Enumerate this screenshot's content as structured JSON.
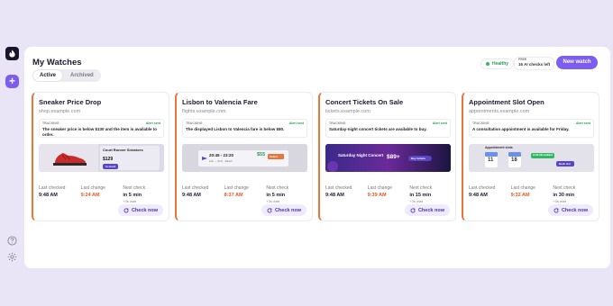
{
  "sidebar": {
    "logo_icon": "flame-logo-icon",
    "add_label": "+",
    "help_icon": "help-icon",
    "settings_icon": "gear-icon"
  },
  "header": {
    "title": "My Watches",
    "tabs": [
      "Active",
      "Archived"
    ],
    "status": "Healthy",
    "plan_name": "FREE",
    "plan_info": "16 AI checks left",
    "new_watch": "New watch"
  },
  "labels": {
    "tracking": "TRACKING",
    "alert": "Alert sent",
    "last_checked": "Last checked",
    "last_change": "Last change",
    "next_check": "Next check",
    "check_now": "Check now"
  },
  "cards": [
    {
      "title": "Sneaker Price Drop",
      "url": "shop.example.com",
      "tracking": "The sneaker price is below $130 and the item is available to order.",
      "last_checked": "9:48 AM",
      "last_change": "9:24 AM",
      "next_check": "in 5 min",
      "next_sub": "+3s wait",
      "preview": {
        "product": "Court Runner Sneakers",
        "price": "$129",
        "badge": "In stock"
      }
    },
    {
      "title": "Lisbon to Valencia Fare",
      "url": "flights.example.com",
      "tracking": "The displayed Lisbon to Valencia fare is below $80.",
      "last_checked": "9:48 AM",
      "last_change": "8:37 AM",
      "next_check": "in 5 min",
      "next_sub": "+3s wait",
      "preview": {
        "times": "20:45 - 23:20",
        "route": "LIS → VLC · Direct",
        "price": "$55",
        "badge": "Select"
      }
    },
    {
      "title": "Concert Tickets On Sale",
      "url": "tickets.example.com",
      "tracking": "Saturday-night concert tickets are available to buy.",
      "last_checked": "9:48 AM",
      "last_change": "9:39 AM",
      "next_check": "in 15 min",
      "next_sub": "+3s wait",
      "preview": {
        "event": "Saturday Night Concert",
        "price": "$89+",
        "badge": "Buy tickets"
      }
    },
    {
      "title": "Appointment Slot Open",
      "url": "appointments.example.com",
      "tracking": "A consultation appointment is available for Friday.",
      "last_checked": "9:48 AM",
      "last_change": "9:32 AM",
      "next_check": "in 30 min",
      "next_sub": "+3s wait",
      "preview": {
        "heading": "Appointment slots",
        "day1": "11",
        "day2": "18",
        "slot": "10:30 AM available",
        "badge": "Book slot"
      }
    }
  ]
}
